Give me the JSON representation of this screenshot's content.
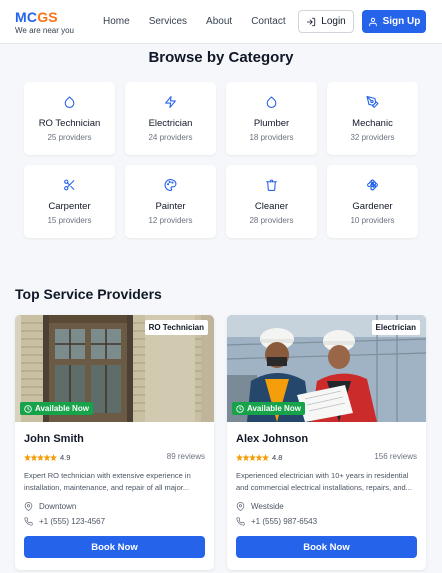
{
  "brand": {
    "logo_a": "MC",
    "logo_b": "GS",
    "tagline": "We are near you"
  },
  "nav": {
    "links": [
      "Home",
      "Services",
      "About",
      "Contact"
    ],
    "login": "Login",
    "signup": "Sign Up"
  },
  "colors": {
    "primary": "#2563eb",
    "accent": "#f97316",
    "available": "#16a34a",
    "star": "#f59e0b"
  },
  "categories_section": {
    "title": "Browse by Category",
    "items": [
      {
        "name": "RO Technician",
        "count": "25 providers",
        "icon": "droplet-icon"
      },
      {
        "name": "Electrician",
        "count": "24 providers",
        "icon": "zap-icon"
      },
      {
        "name": "Plumber",
        "count": "18 providers",
        "icon": "droplet-icon"
      },
      {
        "name": "Mechanic",
        "count": "32 providers",
        "icon": "pen-tool-icon"
      },
      {
        "name": "Carpenter",
        "count": "15 providers",
        "icon": "scissors-icon"
      },
      {
        "name": "Painter",
        "count": "12 providers",
        "icon": "palette-icon"
      },
      {
        "name": "Cleaner",
        "count": "28 providers",
        "icon": "trash-icon"
      },
      {
        "name": "Gardener",
        "count": "10 providers",
        "icon": "flower-icon"
      }
    ]
  },
  "providers_section": {
    "title": "Top Service Providers",
    "providers": [
      {
        "category": "RO Technician",
        "available": "Available Now",
        "name": "John Smith",
        "rating": "4.9",
        "rating_value": 4.9,
        "reviews": "89 reviews",
        "description": "Expert RO technician with extensive experience in installation, maintenance, and repair of all major...",
        "location": "Downtown",
        "phone": "+1 (555) 123-4567",
        "book": "Book Now"
      },
      {
        "category": "Electrician",
        "available": "Available Now",
        "name": "Alex Johnson",
        "rating": "4.8",
        "rating_value": 4.8,
        "reviews": "156 reviews",
        "description": "Experienced electrician with 10+ years in residential and commercial electrical installations, repairs, and...",
        "location": "Westside",
        "phone": "+1 (555) 987-6543",
        "book": "Book Now"
      }
    ]
  }
}
